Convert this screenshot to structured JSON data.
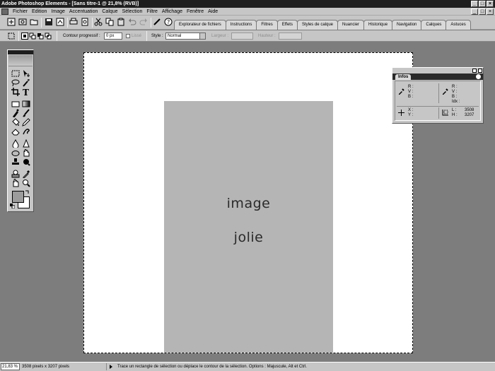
{
  "window": {
    "title": "Adobe Photoshop Elements - [Sans titre-1 @ 21,8% (RVB)]",
    "buttons": [
      "_",
      "□",
      "×"
    ]
  },
  "menubar": {
    "items": [
      "Fichier",
      "Edition",
      "Image",
      "Accentuation",
      "Calque",
      "Sélection",
      "Filtre",
      "Affichage",
      "Fenêtre",
      "Aide"
    ]
  },
  "palette_well": {
    "tabs": [
      "Explorateur de fichiers",
      "Instructions",
      "Filtres",
      "Effets",
      "Styles de calque",
      "Nuancier",
      "Historique",
      "Navigation",
      "Calques",
      "Astuces"
    ]
  },
  "options": {
    "contour_label": "Contour progressif :",
    "contour_value": "0 px",
    "lisse_label": "Lissé",
    "style_label": "Style :",
    "style_value": "Normal",
    "largeur_label": "Largeur :",
    "hauteur_label": "Hauteur :"
  },
  "canvas": {
    "line1": "image",
    "line2": "jolie"
  },
  "infos_panel": {
    "tab": "Infos",
    "rgb_left": "R :\nV :\nB :",
    "rgb_right": "R :\nV :\nB :\nIdx :",
    "xy": "X :\nY :",
    "size_labels": "L :\nH :",
    "width_value": "3508",
    "height_value": "3207"
  },
  "statusbar": {
    "zoom": "21,83 %",
    "doc_size": "3508 pixels x 3207 pixels",
    "message": "Trace un rectangle de sélection ou déplace le contour de la sélection. Options : Majuscule, Alt et Ctrl."
  }
}
